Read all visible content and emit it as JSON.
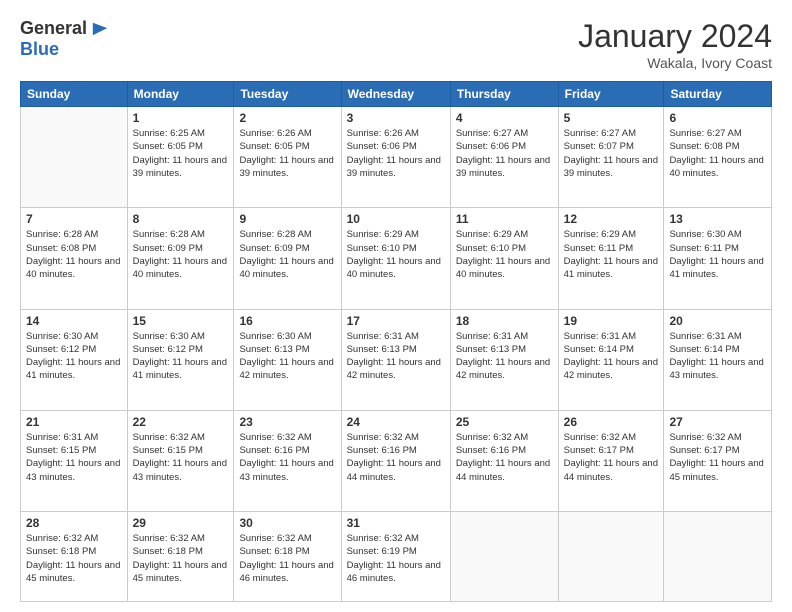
{
  "logo": {
    "general": "General",
    "blue": "Blue"
  },
  "header": {
    "month": "January 2024",
    "location": "Wakala, Ivory Coast"
  },
  "days_of_week": [
    "Sunday",
    "Monday",
    "Tuesday",
    "Wednesday",
    "Thursday",
    "Friday",
    "Saturday"
  ],
  "weeks": [
    [
      {
        "day": "",
        "info": ""
      },
      {
        "day": "1",
        "info": "Sunrise: 6:25 AM\nSunset: 6:05 PM\nDaylight: 11 hours and 39 minutes."
      },
      {
        "day": "2",
        "info": "Sunrise: 6:26 AM\nSunset: 6:05 PM\nDaylight: 11 hours and 39 minutes."
      },
      {
        "day": "3",
        "info": "Sunrise: 6:26 AM\nSunset: 6:06 PM\nDaylight: 11 hours and 39 minutes."
      },
      {
        "day": "4",
        "info": "Sunrise: 6:27 AM\nSunset: 6:06 PM\nDaylight: 11 hours and 39 minutes."
      },
      {
        "day": "5",
        "info": "Sunrise: 6:27 AM\nSunset: 6:07 PM\nDaylight: 11 hours and 39 minutes."
      },
      {
        "day": "6",
        "info": "Sunrise: 6:27 AM\nSunset: 6:08 PM\nDaylight: 11 hours and 40 minutes."
      }
    ],
    [
      {
        "day": "7",
        "info": "Sunrise: 6:28 AM\nSunset: 6:08 PM\nDaylight: 11 hours and 40 minutes."
      },
      {
        "day": "8",
        "info": "Sunrise: 6:28 AM\nSunset: 6:09 PM\nDaylight: 11 hours and 40 minutes."
      },
      {
        "day": "9",
        "info": "Sunrise: 6:28 AM\nSunset: 6:09 PM\nDaylight: 11 hours and 40 minutes."
      },
      {
        "day": "10",
        "info": "Sunrise: 6:29 AM\nSunset: 6:10 PM\nDaylight: 11 hours and 40 minutes."
      },
      {
        "day": "11",
        "info": "Sunrise: 6:29 AM\nSunset: 6:10 PM\nDaylight: 11 hours and 40 minutes."
      },
      {
        "day": "12",
        "info": "Sunrise: 6:29 AM\nSunset: 6:11 PM\nDaylight: 11 hours and 41 minutes."
      },
      {
        "day": "13",
        "info": "Sunrise: 6:30 AM\nSunset: 6:11 PM\nDaylight: 11 hours and 41 minutes."
      }
    ],
    [
      {
        "day": "14",
        "info": "Sunrise: 6:30 AM\nSunset: 6:12 PM\nDaylight: 11 hours and 41 minutes."
      },
      {
        "day": "15",
        "info": "Sunrise: 6:30 AM\nSunset: 6:12 PM\nDaylight: 11 hours and 41 minutes."
      },
      {
        "day": "16",
        "info": "Sunrise: 6:30 AM\nSunset: 6:13 PM\nDaylight: 11 hours and 42 minutes."
      },
      {
        "day": "17",
        "info": "Sunrise: 6:31 AM\nSunset: 6:13 PM\nDaylight: 11 hours and 42 minutes."
      },
      {
        "day": "18",
        "info": "Sunrise: 6:31 AM\nSunset: 6:13 PM\nDaylight: 11 hours and 42 minutes."
      },
      {
        "day": "19",
        "info": "Sunrise: 6:31 AM\nSunset: 6:14 PM\nDaylight: 11 hours and 42 minutes."
      },
      {
        "day": "20",
        "info": "Sunrise: 6:31 AM\nSunset: 6:14 PM\nDaylight: 11 hours and 43 minutes."
      }
    ],
    [
      {
        "day": "21",
        "info": "Sunrise: 6:31 AM\nSunset: 6:15 PM\nDaylight: 11 hours and 43 minutes."
      },
      {
        "day": "22",
        "info": "Sunrise: 6:32 AM\nSunset: 6:15 PM\nDaylight: 11 hours and 43 minutes."
      },
      {
        "day": "23",
        "info": "Sunrise: 6:32 AM\nSunset: 6:16 PM\nDaylight: 11 hours and 43 minutes."
      },
      {
        "day": "24",
        "info": "Sunrise: 6:32 AM\nSunset: 6:16 PM\nDaylight: 11 hours and 44 minutes."
      },
      {
        "day": "25",
        "info": "Sunrise: 6:32 AM\nSunset: 6:16 PM\nDaylight: 11 hours and 44 minutes."
      },
      {
        "day": "26",
        "info": "Sunrise: 6:32 AM\nSunset: 6:17 PM\nDaylight: 11 hours and 44 minutes."
      },
      {
        "day": "27",
        "info": "Sunrise: 6:32 AM\nSunset: 6:17 PM\nDaylight: 11 hours and 45 minutes."
      }
    ],
    [
      {
        "day": "28",
        "info": "Sunrise: 6:32 AM\nSunset: 6:18 PM\nDaylight: 11 hours and 45 minutes."
      },
      {
        "day": "29",
        "info": "Sunrise: 6:32 AM\nSunset: 6:18 PM\nDaylight: 11 hours and 45 minutes."
      },
      {
        "day": "30",
        "info": "Sunrise: 6:32 AM\nSunset: 6:18 PM\nDaylight: 11 hours and 46 minutes."
      },
      {
        "day": "31",
        "info": "Sunrise: 6:32 AM\nSunset: 6:19 PM\nDaylight: 11 hours and 46 minutes."
      },
      {
        "day": "",
        "info": ""
      },
      {
        "day": "",
        "info": ""
      },
      {
        "day": "",
        "info": ""
      }
    ]
  ]
}
